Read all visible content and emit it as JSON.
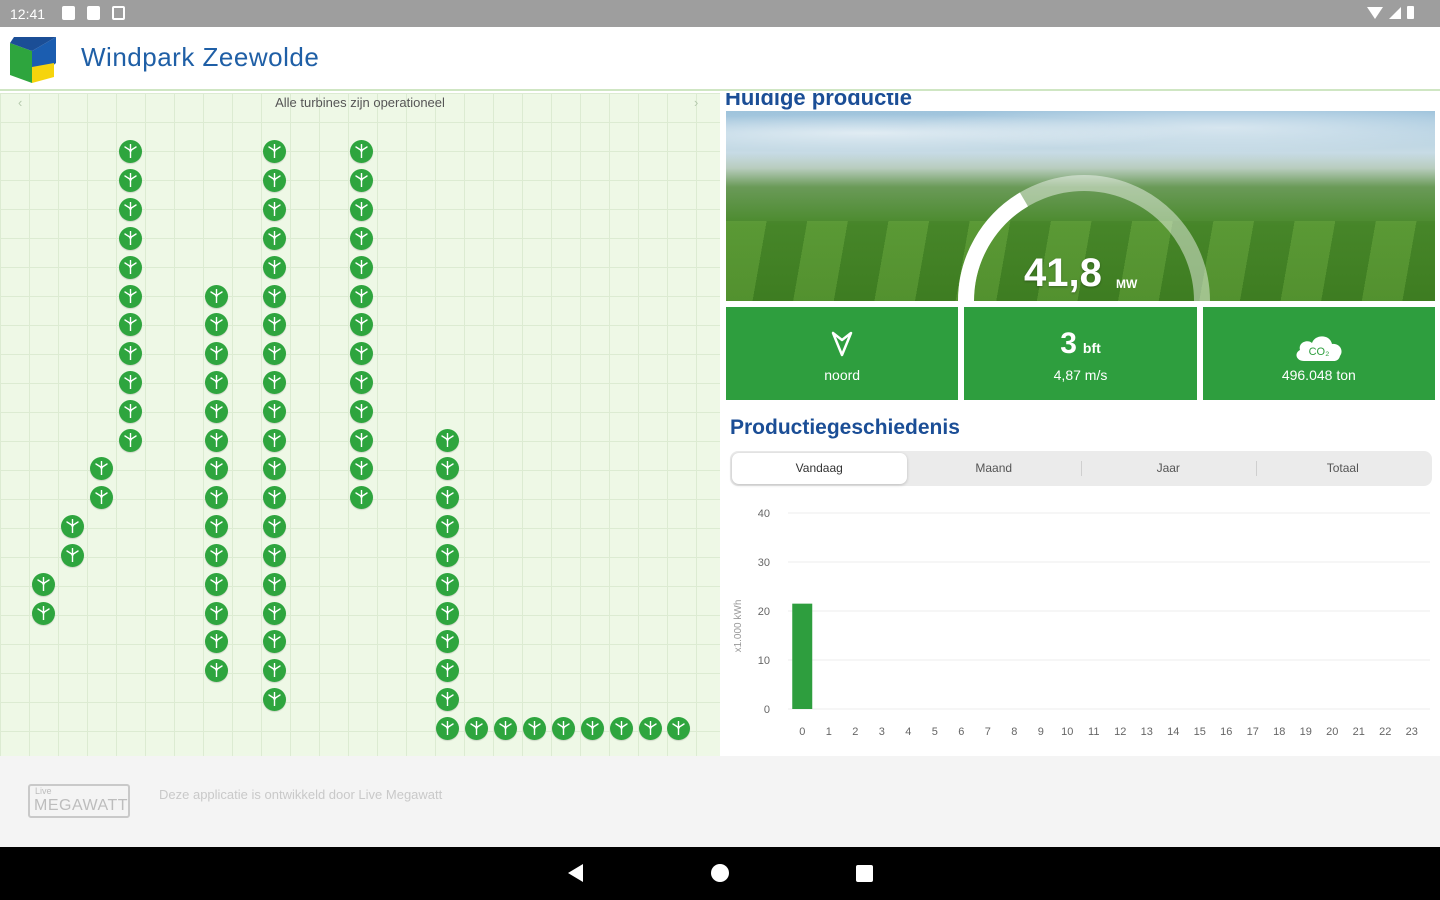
{
  "status_bar": {
    "time": "12:41"
  },
  "app": {
    "title": "Windpark Zeewolde"
  },
  "map": {
    "status": "Alle turbines zijn operationeel",
    "turbine_rows": [
      {
        "x": 130,
        "rows": [
          151,
          180,
          209,
          238,
          267,
          296,
          324,
          353,
          382,
          411,
          440
        ]
      },
      {
        "x": 101,
        "rows": [
          468,
          497
        ]
      },
      {
        "x": 72,
        "rows": [
          526,
          555
        ]
      },
      {
        "x": 43,
        "rows": [
          584,
          613
        ]
      },
      {
        "x": 216,
        "rows": [
          296,
          324,
          353,
          382,
          411,
          440,
          468,
          497,
          526,
          555,
          584,
          613,
          641,
          670
        ]
      },
      {
        "x": 274,
        "rows": [
          151,
          180,
          209,
          238,
          267,
          296,
          324,
          353,
          382,
          411,
          440,
          468,
          497,
          526,
          555,
          584,
          613,
          641,
          670,
          699
        ]
      },
      {
        "x": 361,
        "rows": [
          151,
          180,
          209,
          238,
          267,
          296,
          324,
          353,
          382,
          411,
          440,
          468,
          497
        ]
      },
      {
        "x": 447,
        "rows": [
          440,
          468,
          497,
          526,
          555,
          584,
          613,
          641,
          670,
          699,
          728
        ]
      }
    ],
    "turbine_bottom_row": {
      "y": 728,
      "xs": [
        476,
        505,
        534,
        563,
        592,
        621,
        650,
        678
      ]
    }
  },
  "current": {
    "section_title": "Huidige productie",
    "value": "41,8",
    "unit": "MW",
    "gauge_fraction": 0.33,
    "wind_direction": "noord",
    "beaufort": "3",
    "beaufort_unit": "bft",
    "wind_speed": "4,87 m/s",
    "co2_icon_text": "CO₂",
    "co2_saved": "496.048 ton"
  },
  "history": {
    "title": "Productiegeschiedenis",
    "tabs": [
      "Vandaag",
      "Maand",
      "Jaar",
      "Totaal"
    ],
    "active_tab": "Vandaag"
  },
  "chart_data": {
    "type": "bar",
    "ylabel": "x1.000 kWh",
    "ylim": [
      0,
      40
    ],
    "yticks": [
      0,
      10,
      20,
      30,
      40
    ],
    "categories": [
      "0",
      "1",
      "2",
      "3",
      "4",
      "5",
      "6",
      "7",
      "8",
      "9",
      "10",
      "11",
      "12",
      "13",
      "14",
      "15",
      "16",
      "17",
      "18",
      "19",
      "20",
      "21",
      "22",
      "23"
    ],
    "values": [
      21.5,
      0,
      0,
      0,
      0,
      0,
      0,
      0,
      0,
      0,
      0,
      0,
      0,
      0,
      0,
      0,
      0,
      0,
      0,
      0,
      0,
      0,
      0,
      0
    ],
    "color": "#2e9e3e"
  },
  "footer": {
    "logo_small": "Live",
    "logo_big": "MEGAWATT",
    "text": "Deze applicatie is ontwikkeld door Live Megawatt"
  },
  "colors": {
    "brand_blue": "#1b4e96",
    "green": "#2e9e3e"
  }
}
